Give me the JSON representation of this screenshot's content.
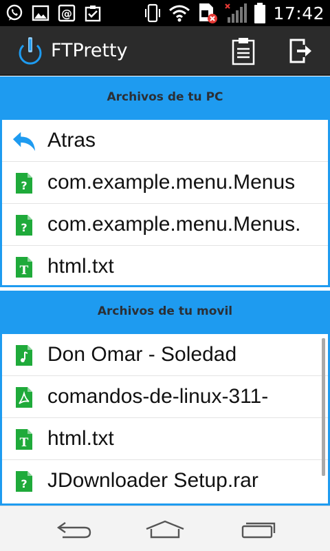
{
  "status_bar": {
    "time": "17:42",
    "left_icons": [
      "whatsapp-icon",
      "gallery-icon",
      "email-icon",
      "clipboard-check-icon"
    ],
    "right_icons": [
      "vibrate-icon",
      "wifi-icon",
      "sim-error-icon",
      "signal-icon",
      "battery-icon"
    ]
  },
  "action_bar": {
    "title": "FTPretty",
    "logo_icon": "power-logo-icon",
    "actions": [
      "clipboard-icon",
      "exit-icon"
    ]
  },
  "sections": {
    "pc": {
      "title": "Archivos de tu PC",
      "items": [
        {
          "name": "Atras",
          "icon": "back-arrow-icon"
        },
        {
          "name": "com.example.menu.Menus",
          "icon": "unknown-file-icon"
        },
        {
          "name": "com.example.menu.Menus.",
          "icon": "unknown-file-icon"
        },
        {
          "name": "html.txt",
          "icon": "text-file-icon"
        }
      ]
    },
    "movil": {
      "title": "Archivos de tu movil",
      "items": [
        {
          "name": "Don Omar - Soledad",
          "icon": "music-file-icon"
        },
        {
          "name": "comandos-de-linux-311-",
          "icon": "pdf-file-icon"
        },
        {
          "name": "html.txt",
          "icon": "text-file-icon"
        },
        {
          "name": "JDownloader Setup.rar",
          "icon": "unknown-file-icon"
        }
      ]
    }
  },
  "colors": {
    "accent": "#1e9bf0",
    "file_icon_green": "#1faa3a",
    "action_bar": "#2b2b2b"
  }
}
